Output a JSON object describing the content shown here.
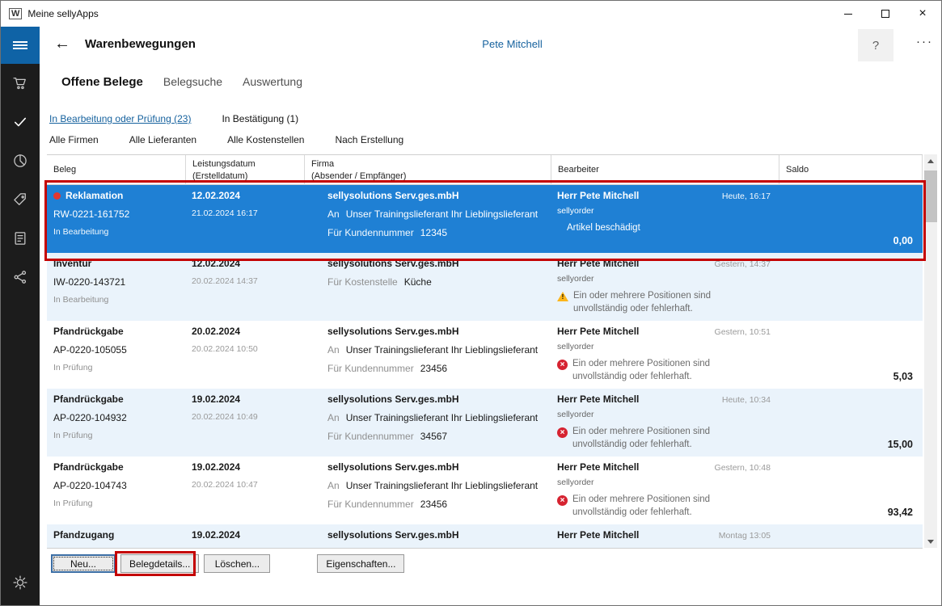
{
  "colors": {
    "accent": "#0f63a6",
    "selected_row": "#1f80d4",
    "link": "#16629e",
    "annotation": "#c40000",
    "warning": "#fcb61c",
    "error": "#d62331",
    "row_alt": "#eaf3fb",
    "sidebar_bg": "#1c1c1c"
  },
  "window": {
    "title": "Meine sellyApps",
    "app_icon": "W"
  },
  "header": {
    "title": "Warenbewegungen",
    "user_name": "Pete Mitchell",
    "help_label": "?",
    "more_label": "···"
  },
  "sidebar": {
    "items": [
      {
        "name": "menu-icon"
      },
      {
        "name": "cart-icon"
      },
      {
        "name": "checkmark-icon",
        "active": true
      },
      {
        "name": "pie-chart-icon"
      },
      {
        "name": "tag-icon"
      },
      {
        "name": "journal-icon"
      },
      {
        "name": "share-icon"
      },
      {
        "name": "gear-icon"
      }
    ]
  },
  "tabs": [
    {
      "label": "Offene Belege",
      "active": true
    },
    {
      "label": "Belegsuche",
      "active": false
    },
    {
      "label": "Auswertung",
      "active": false
    }
  ],
  "status_filters": [
    {
      "label": "In Bearbeitung oder Prüfung (23)",
      "active": true
    },
    {
      "label": "In Bestätigung (1)",
      "active": false
    }
  ],
  "dropdown_filters": [
    {
      "label": "Alle Firmen"
    },
    {
      "label": "Alle Lieferanten"
    },
    {
      "label": "Alle Kostenstellen"
    },
    {
      "label": "Nach Erstellung"
    }
  ],
  "table": {
    "columns": [
      {
        "line1": "Beleg",
        "line2": ""
      },
      {
        "line1": "Leistungsdatum",
        "line2": "(Erstelldatum)"
      },
      {
        "line1": "Firma",
        "line2": "(Absender / Empfänger)"
      },
      {
        "line1": "Bearbeiter",
        "line2": ""
      },
      {
        "line1": "Saldo",
        "line2": ""
      }
    ],
    "rows": [
      {
        "type": "Reklamation",
        "marker": true,
        "selected": true,
        "doc_number": "RW-0221-161752",
        "status": "In Bearbeitung",
        "service_date": "12.02.2024",
        "created_date": "21.02.2024 16:17",
        "company": "sellysolutions Serv.ges.mbH",
        "line2_prefix": "An",
        "line2_text": "Unser Trainingslieferant Ihr Lieblingslieferant",
        "line3_prefix": "Für Kundennummer",
        "line3_text": "12345",
        "editor": "Herr Pete Mitchell",
        "editor_sub": "sellyorder",
        "time": "Heute, 16:17",
        "note": "Artikel beschädigt",
        "note_icon": "none",
        "saldo": "0,00"
      },
      {
        "type": "Inventur",
        "marker": false,
        "selected": false,
        "doc_number": "IW-0220-143721",
        "status": "In Bearbeitung",
        "service_date": "12.02.2024",
        "created_date": "20.02.2024 14:37",
        "company": "sellysolutions Serv.ges.mbH",
        "line2_prefix": "Für Kostenstelle",
        "line2_text": "Küche",
        "line3_prefix": "",
        "line3_text": "",
        "editor": "Herr Pete Mitchell",
        "editor_sub": "sellyorder",
        "time": "Gestern, 14:37",
        "note": "Ein oder mehrere Positionen sind unvollständig oder fehlerhaft.",
        "note_icon": "warning",
        "saldo": ""
      },
      {
        "type": "Pfandrückgabe",
        "marker": false,
        "selected": false,
        "doc_number": "AP-0220-105055",
        "status": "In Prüfung",
        "service_date": "20.02.2024",
        "created_date": "20.02.2024 10:50",
        "company": "sellysolutions Serv.ges.mbH",
        "line2_prefix": "An",
        "line2_text": "Unser Trainingslieferant Ihr Lieblingslieferant",
        "line3_prefix": "Für Kundennummer",
        "line3_text": "23456",
        "editor": "Herr Pete Mitchell",
        "editor_sub": "sellyorder",
        "time": "Gestern, 10:51",
        "note": "Ein oder mehrere Positionen sind unvollständig oder fehlerhaft.",
        "note_icon": "error",
        "saldo": "5,03"
      },
      {
        "type": "Pfandrückgabe",
        "marker": false,
        "selected": false,
        "doc_number": "AP-0220-104932",
        "status": "In Prüfung",
        "service_date": "19.02.2024",
        "created_date": "20.02.2024 10:49",
        "company": "sellysolutions Serv.ges.mbH",
        "line2_prefix": "An",
        "line2_text": "Unser Trainingslieferant Ihr Lieblingslieferant",
        "line3_prefix": "Für Kundennummer",
        "line3_text": "34567",
        "editor": "Herr Pete Mitchell",
        "editor_sub": "sellyorder",
        "time": "Heute, 10:34",
        "note": "Ein oder mehrere Positionen sind unvollständig oder fehlerhaft.",
        "note_icon": "error",
        "saldo": "15,00"
      },
      {
        "type": "Pfandrückgabe",
        "marker": false,
        "selected": false,
        "doc_number": "AP-0220-104743",
        "status": "In Prüfung",
        "service_date": "19.02.2024",
        "created_date": "20.02.2024 10:47",
        "company": "sellysolutions Serv.ges.mbH",
        "line2_prefix": "An",
        "line2_text": "Unser Trainingslieferant Ihr Lieblingslieferant",
        "line3_prefix": "Für Kundennummer",
        "line3_text": "23456",
        "editor": "Herr Pete Mitchell",
        "editor_sub": "sellyorder",
        "time": "Gestern, 10:48",
        "note": "Ein oder mehrere Positionen sind unvollständig oder fehlerhaft.",
        "note_icon": "error",
        "saldo": "93,42"
      },
      {
        "type": "Pfandzugang",
        "marker": false,
        "selected": false,
        "doc_number": "",
        "status": "",
        "service_date": "19.02.2024",
        "created_date": "",
        "company": "sellysolutions Serv.ges.mbH",
        "line2_prefix": "",
        "line2_text": "",
        "line3_prefix": "",
        "line3_text": "",
        "editor": "Herr Pete Mitchell",
        "editor_sub": "",
        "time": "Montag 13:05",
        "note": "",
        "note_icon": "none",
        "saldo": ""
      }
    ]
  },
  "footer_buttons": [
    {
      "label": "Neu...",
      "focused": true
    },
    {
      "label": "Belegdetails...",
      "highlighted": true
    },
    {
      "label": "Löschen..."
    },
    {
      "label": "Eigenschaften..."
    }
  ]
}
